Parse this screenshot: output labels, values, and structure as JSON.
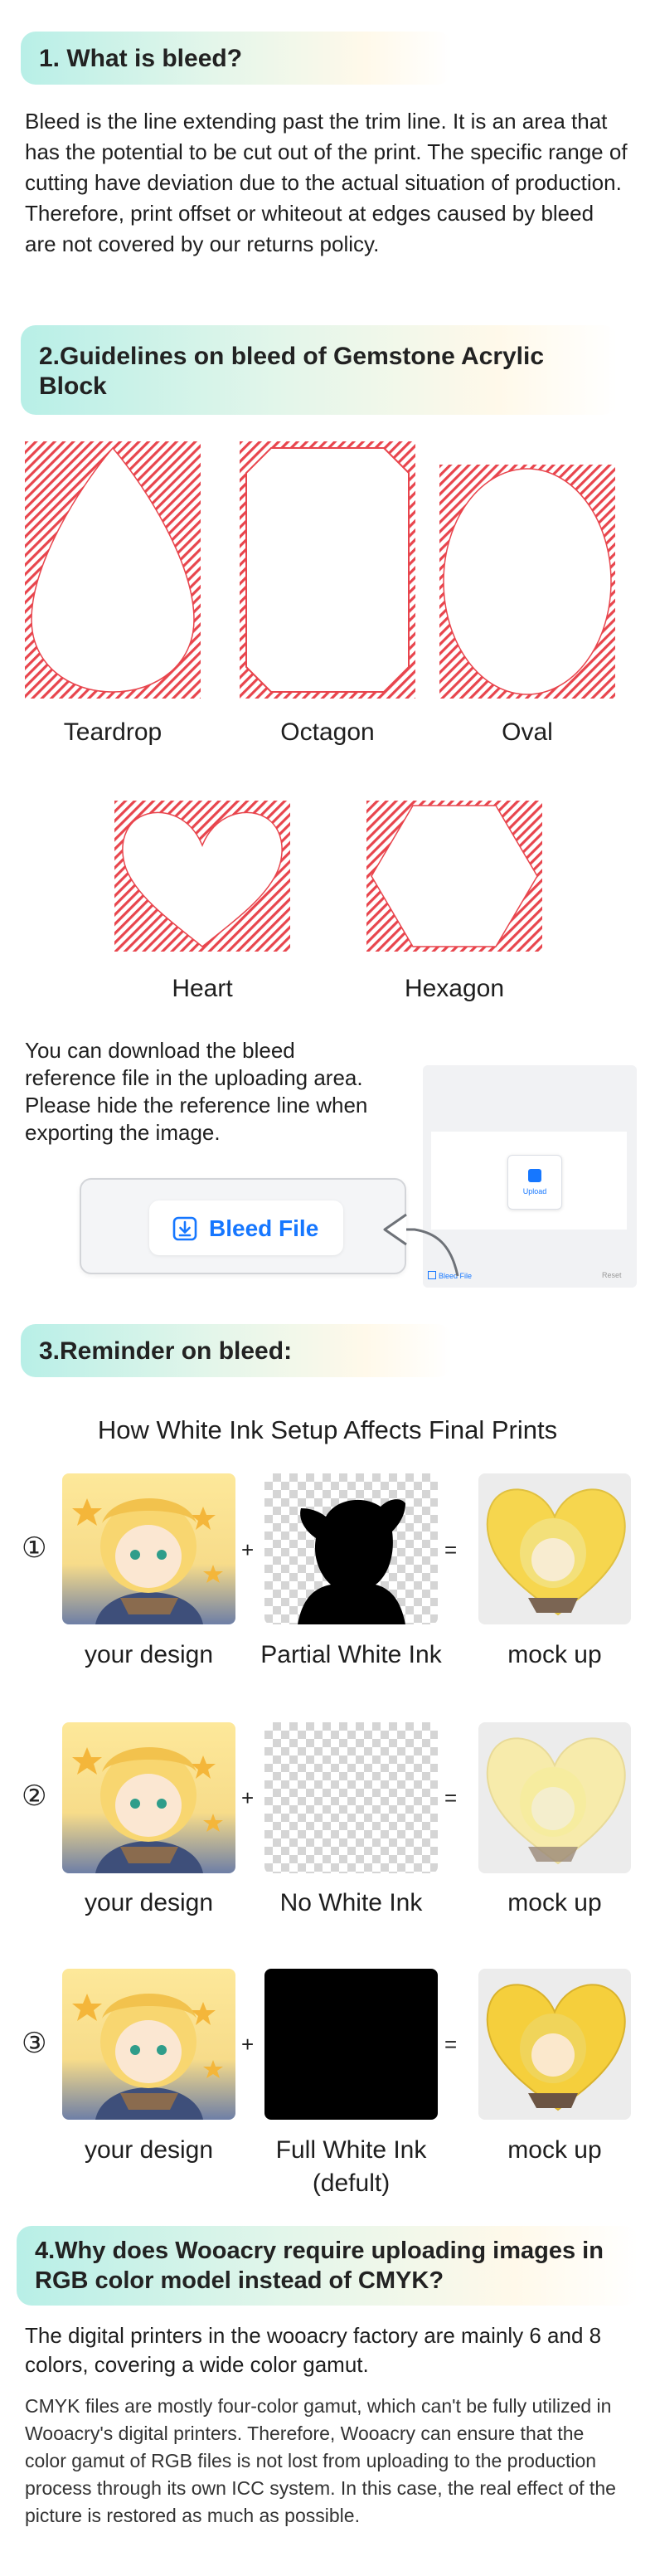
{
  "section1": {
    "title": "1. What is bleed?",
    "body": "Bleed is the line extending past the trim line. It is an area that has the potential to be cut out of the print. The specific range of cutting have deviation due to the actual situation of production. Therefore, print offset or whiteout at edges caused by bleed are not covered by our returns policy."
  },
  "section2": {
    "title": "2.Guidelines on bleed of  Gemstone Acrylic Block",
    "shapes": [
      "Teardrop",
      "Octagon",
      "Oval",
      "Heart",
      "Hexagon"
    ],
    "download_text": "You can download the bleed reference file in the uploading area. Please hide the reference line when exporting the image.",
    "bleed_button": "Bleed File",
    "upload_label": "Upload",
    "mini_bleed": "Bleed File",
    "mini_reset": "Reset"
  },
  "section3": {
    "title": "3.Reminder on bleed:",
    "subtitle": "How White Ink Setup Affects Final Prints",
    "rows": [
      {
        "num": "①",
        "design": "your design",
        "ink": "Partial White Ink",
        "ink2": "",
        "mock": "mock up"
      },
      {
        "num": "②",
        "design": "your design",
        "ink": "No White Ink",
        "ink2": "",
        "mock": "mock up"
      },
      {
        "num": "③",
        "design": "your design",
        "ink": "Full White Ink",
        "ink2": "(defult)",
        "mock": "mock up"
      }
    ],
    "plus": "+",
    "equals": "="
  },
  "section4": {
    "title": "4.Why does Wooacry require uploading images in RGB color model instead of CMYK?",
    "body1": "The digital printers in the wooacry factory are mainly 6 and 8 colors, covering a wide color gamut.",
    "body2": "CMYK files are mostly four-color gamut, which can't be fully utilized in Wooacry's digital printers. Therefore, Wooacry can ensure that the color gamut of RGB files is not lost from uploading to the production process through its own ICC system. In this case, the real effect of the picture is restored as much as possible."
  },
  "colors": {
    "bleed_red": "#e8454d",
    "accent_blue": "#1677ff"
  }
}
